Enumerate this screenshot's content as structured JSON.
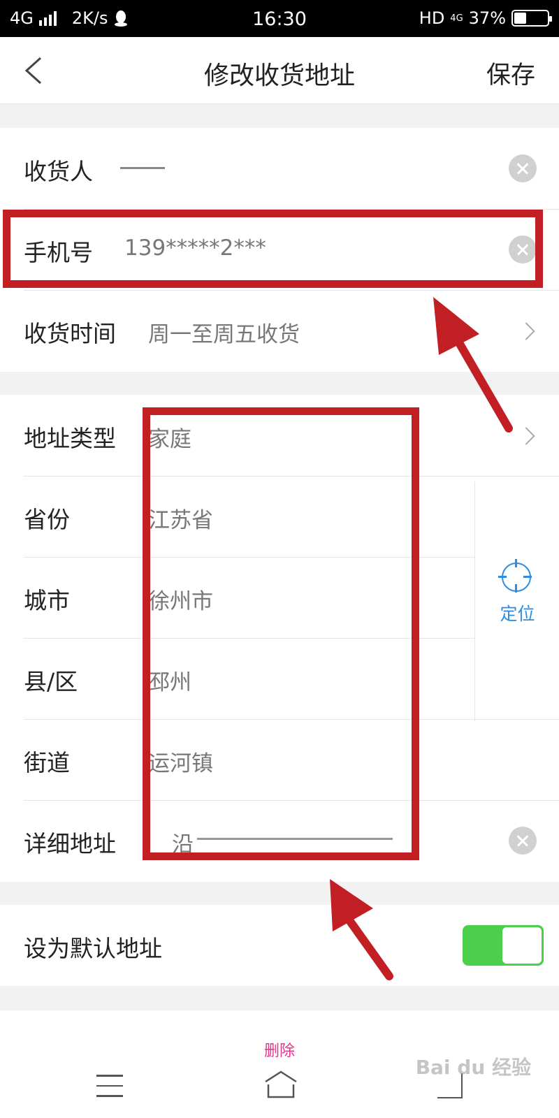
{
  "status_bar": {
    "network": "4G",
    "speed": "2K/s",
    "time": "16:30",
    "hd": "HD",
    "net_small": "4G",
    "battery": "37%",
    "battery_level": 0.37
  },
  "nav": {
    "title": "修改收货地址",
    "save_label": "保存"
  },
  "contact": {
    "receiver_label": "收货人",
    "receiver_value": "",
    "phone_label": "手机号",
    "phone_value": "139*****2***",
    "delivery_time_label": "收货时间",
    "delivery_time_value": "周一至周五收货"
  },
  "address": {
    "type_label": "地址类型",
    "type_value": "家庭",
    "province_label": "省份",
    "province_value": "江苏省",
    "city_label": "城市",
    "city_value": "徐州市",
    "district_label": "县/区",
    "district_value": "邳州",
    "street_label": "街道",
    "street_value": "运河镇",
    "detail_label": "详细地址",
    "detail_value": "沿",
    "locate_label": "定位"
  },
  "default": {
    "label": "设为默认地址",
    "enabled": true
  },
  "bottom": {
    "delete_label": "删除",
    "watermark": "Bai du 经验"
  },
  "colors": {
    "accent_blue": "#2d8de0",
    "toggle_green": "#4cd04c",
    "delete_pink": "#e0368a",
    "annotation_red": "#c21f24"
  }
}
